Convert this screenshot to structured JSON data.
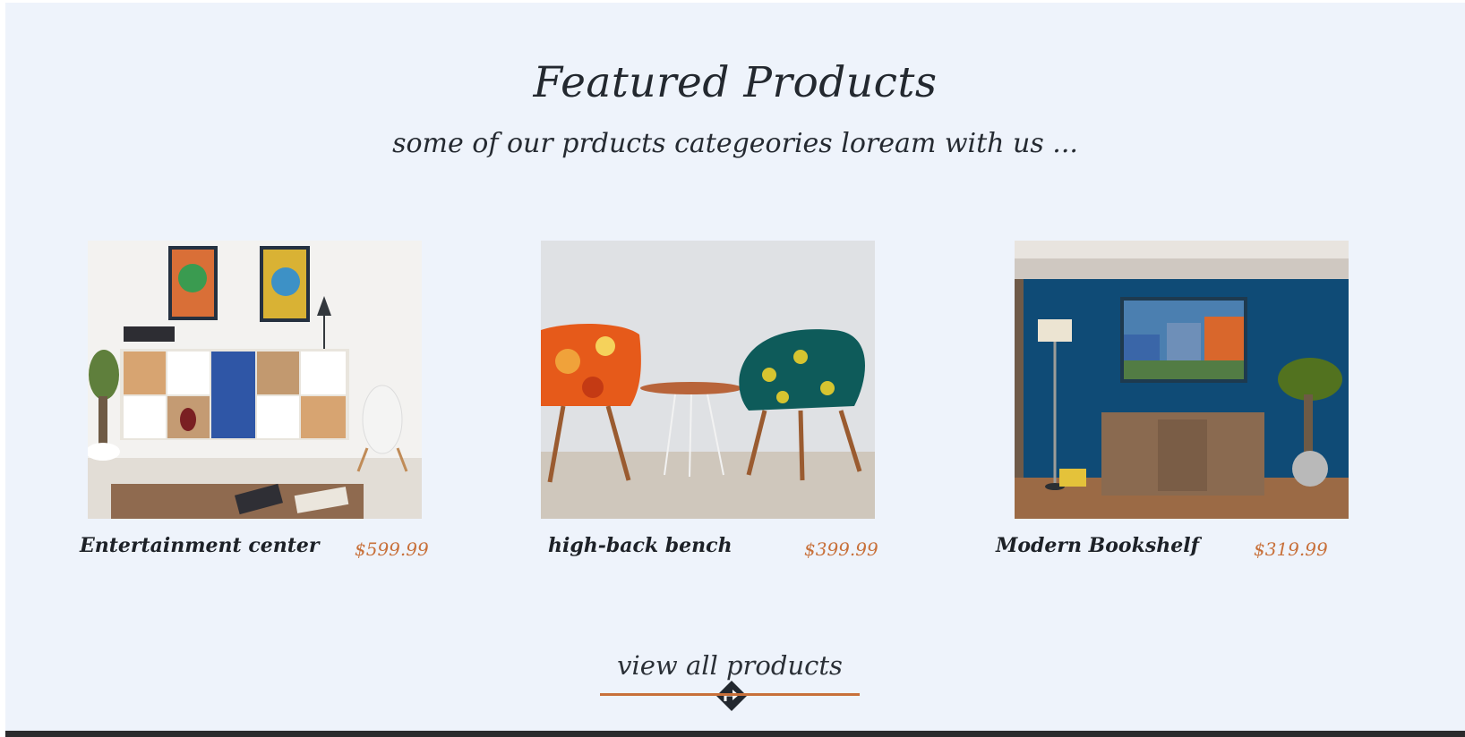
{
  "section": {
    "title": "Featured Products",
    "subtitle": "some of our prducts categeories loream with us ..."
  },
  "products": [
    {
      "name": "Entertainment center",
      "price": "$599.99",
      "image": "furniture-photo-cabinet"
    },
    {
      "name": "high-back bench",
      "price": "$399.99",
      "image": "furniture-photo-chairs"
    },
    {
      "name": "Modern Bookshelf",
      "price": "$319.99",
      "image": "furniture-photo-sideboard"
    }
  ],
  "cta": {
    "label": "view all products",
    "icon": "turn-right-arrow-icon"
  },
  "colors": {
    "background": "#eef3fb",
    "accent": "#c8703a",
    "text": "#222831",
    "footer": "#2b2b2d"
  }
}
